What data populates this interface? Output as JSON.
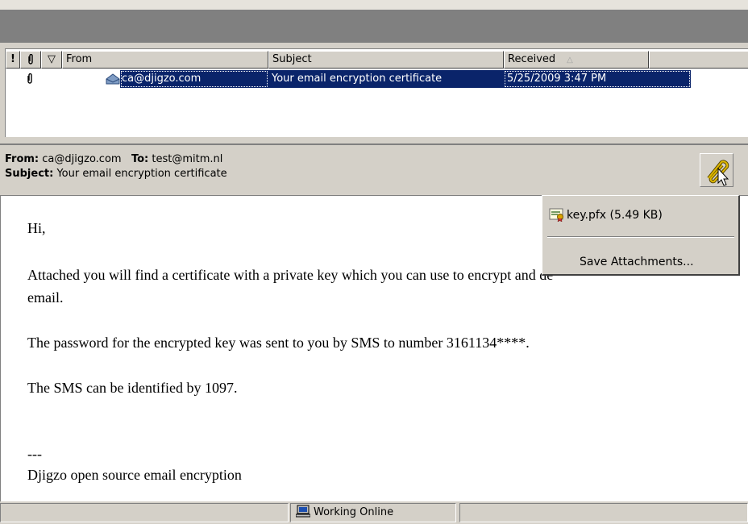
{
  "columns": {
    "importance": "!",
    "attachment": "📎",
    "flag": "▽",
    "from": "From",
    "subject": "Subject",
    "received": "Received",
    "sort_indicator": "△"
  },
  "message": {
    "from": "ca@djigzo.com",
    "subject": "Your email encryption certificate",
    "received": "5/25/2009 3:47 PM"
  },
  "preview": {
    "from_label": "From:",
    "from_value": "ca@djigzo.com",
    "to_label": "To:",
    "to_value": "test@mitm.nl",
    "subject_label": "Subject:",
    "subject_value": "Your email encryption certificate"
  },
  "body": {
    "greeting": "Hi,",
    "line1": "Attached you will find a certificate with a private key which you can use to encrypt and de",
    "line1b": "email.",
    "line2": "The password for the encrypted key was sent to you by SMS to number 3161134****.",
    "line3": "The SMS can be identified by 1097.",
    "sig_sep": "---",
    "signature": "Djigzo open source email encryption"
  },
  "attachment_menu": {
    "file": "key.pfx (5.49 KB)",
    "save": "Save Attachments..."
  },
  "status": {
    "online": "Working Online"
  },
  "colors": {
    "chrome": "#d4d0c8",
    "selection": "#0a246a",
    "dark_bar": "#808080"
  }
}
